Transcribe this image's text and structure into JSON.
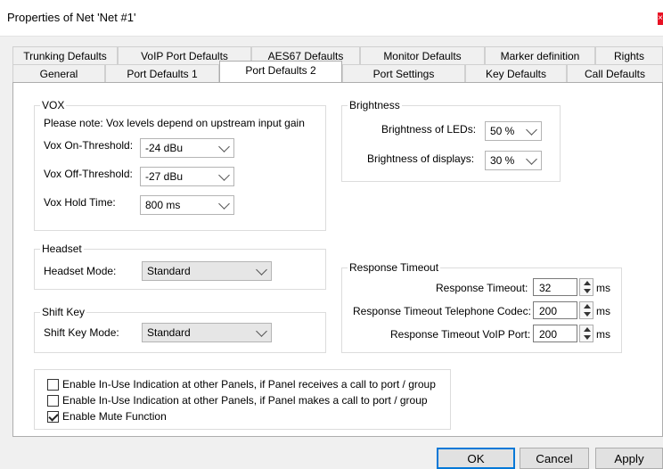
{
  "window": {
    "title": "Properties of Net 'Net #1'",
    "close_glyph": "×"
  },
  "tabs_top": [
    "Trunking Defaults",
    "VoIP Port Defaults",
    "AES67 Defaults",
    "Monitor Defaults",
    "Marker definition",
    "Rights"
  ],
  "tabs_bottom": [
    "General",
    "Port Defaults 1",
    "Port Defaults 2",
    "Port Settings",
    "Key Defaults",
    "Call Defaults"
  ],
  "active_tab": "Port Defaults 2",
  "vox": {
    "group_label": "VOX",
    "note": "Please note: Vox levels depend on upstream input gain",
    "on_label": "Vox On-Threshold:",
    "on_value": "-24 dBu",
    "off_label": "Vox Off-Threshold:",
    "off_value": "-27 dBu",
    "hold_label": "Vox Hold Time:",
    "hold_value": "800 ms"
  },
  "brightness": {
    "group_label": "Brightness",
    "leds_label": "Brightness of LEDs:",
    "leds_value": "50 %",
    "displays_label": "Brightness of displays:",
    "displays_value": "30 %"
  },
  "headset": {
    "group_label": "Headset",
    "mode_label": "Headset Mode:",
    "mode_value": "Standard"
  },
  "shift_key": {
    "group_label": "Shift Key",
    "mode_label": "Shift Key Mode:",
    "mode_value": "Standard"
  },
  "response_timeout": {
    "group_label": "Response Timeout",
    "timeout_label": "Response Timeout:",
    "timeout_value": "32",
    "tel_label": "Response Timeout Telephone Codec:",
    "tel_value": "200",
    "voip_label": "Response Timeout VoIP Port:",
    "voip_value": "200",
    "unit": "ms"
  },
  "options": [
    {
      "label": "Enable In-Use Indication at other Panels, if Panel receives a call to port / group",
      "checked": false
    },
    {
      "label": "Enable In-Use Indication at other Panels, if Panel makes a call to port / group",
      "checked": false
    },
    {
      "label": "Enable Mute Function",
      "checked": true
    }
  ],
  "buttons": {
    "ok": "OK",
    "cancel": "Cancel",
    "apply": "Apply"
  }
}
